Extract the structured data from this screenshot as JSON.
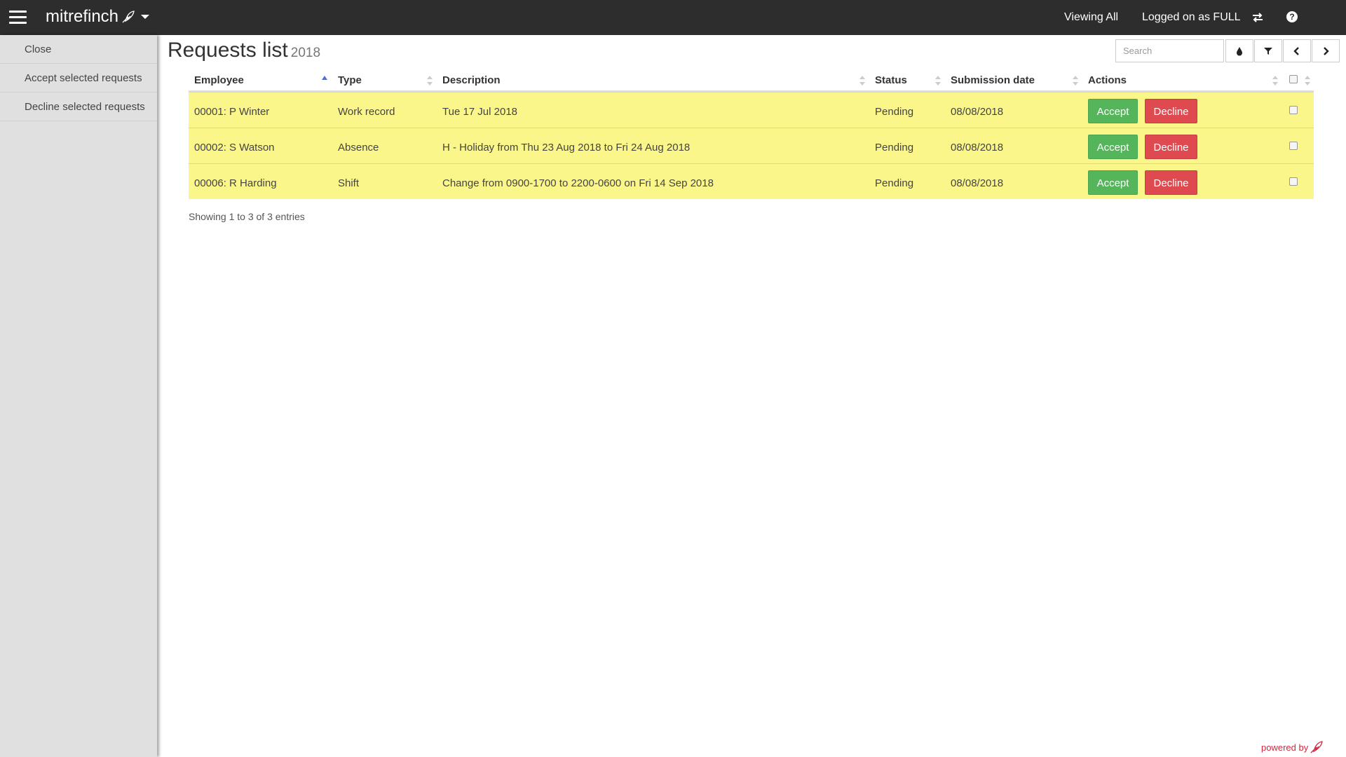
{
  "topbar": {
    "brand": "mitrefinch",
    "viewing": "Viewing All",
    "logged_on": "Logged on as FULL"
  },
  "sidebar": {
    "items": [
      {
        "label": "Close"
      },
      {
        "label": "Accept selected requests"
      },
      {
        "label": "Decline selected requests"
      }
    ]
  },
  "page": {
    "title": "Requests list",
    "year": "2018"
  },
  "search": {
    "placeholder": "Search"
  },
  "table": {
    "columns": [
      "Employee",
      "Type",
      "Description",
      "Status",
      "Submission date",
      "Actions"
    ],
    "rows": [
      {
        "employee": "00001: P Winter",
        "type": "Work record",
        "description": "Tue 17 Jul 2018",
        "status": "Pending",
        "date": "08/08/2018",
        "accept": "Accept",
        "decline": "Decline"
      },
      {
        "employee": "00002: S Watson",
        "type": "Absence",
        "description": "H - Holiday from Thu 23 Aug 2018 to Fri 24 Aug 2018",
        "status": "Pending",
        "date": "08/08/2018",
        "accept": "Accept",
        "decline": "Decline"
      },
      {
        "employee": "00006: R Harding",
        "type": "Shift",
        "description": "Change from 0900-1700 to 2200-0600 on Fri 14 Sep 2018",
        "status": "Pending",
        "date": "08/08/2018",
        "accept": "Accept",
        "decline": "Decline"
      }
    ]
  },
  "footer": {
    "showing": "Showing 1 to 3 of 3 entries",
    "powered": "powered by"
  },
  "colors": {
    "topbar": "#2d2d2d",
    "sidebar": "#e0e0e0",
    "row_highlight": "#fbf689",
    "accept": "#55b55a",
    "decline": "#de4a4f",
    "powered": "#d2273c"
  }
}
